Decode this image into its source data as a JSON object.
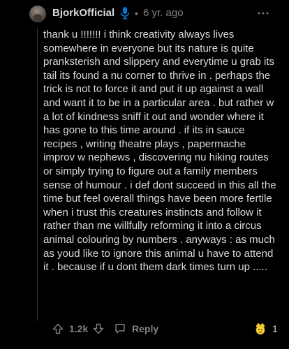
{
  "comment": {
    "author": "BjorkOfficial",
    "separator": "•",
    "age": "6 yr. ago",
    "body": "thank u !!!!!!! i think creativity always lives somewhere in everyone but its nature is quite pranksterish and slippery and everytime u grab its tail its found a nu corner to thrive in . perhaps the trick is not to force it and put it up against a wall and want it to be in a particular area . but rather w a lot of kindness sniff it out and wonder where it has gone to this time around . if its in sauce recipes , writing theatre plays , papermache improv w nephews , discovering nu hiking routes or simply trying to figure out a family members sense of humour . i def dont succeed in this all the time but feel overall things have been more fertile when i trust this creatures instincts and follow it rather than me willfully reforming it into a circus animal colouring by numbers . anyways : as much as youd like to ignore this animal u have to attend it . because if u dont them dark times turn up ....."
  },
  "actions": {
    "vote_count": "1.2k",
    "reply_label": "Reply",
    "award_count": "1"
  },
  "icons": {
    "mic": "microphone-icon",
    "more": "more-options-icon",
    "upvote": "upvote-arrow-icon",
    "downvote": "downvote-arrow-icon",
    "reply": "reply-bubble-icon",
    "award": "award-icon"
  },
  "colors": {
    "background": "#000000",
    "text": "#d7dadc",
    "muted": "#818384",
    "verified_blue": "#0079d3",
    "award_gold": "#ffd635"
  }
}
